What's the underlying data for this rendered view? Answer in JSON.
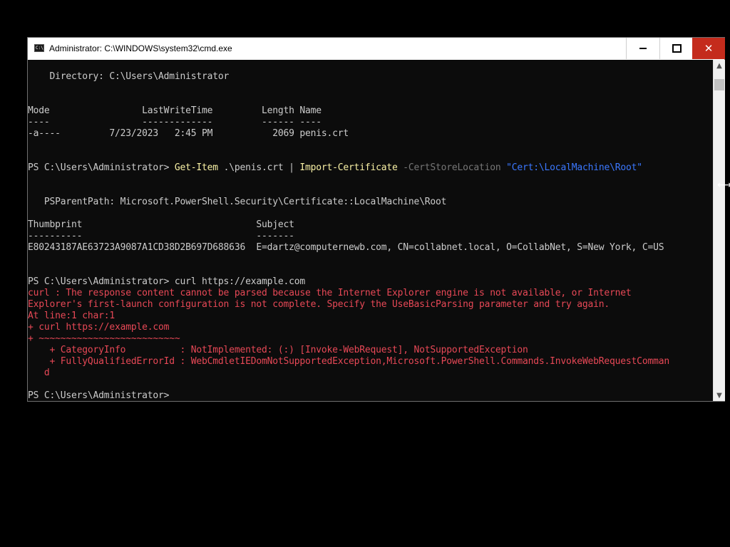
{
  "window": {
    "title": "Administrator: C:\\WINDOWS\\system32\\cmd.exe",
    "icon": "cmd-console-icon",
    "icon_text": "C:\\"
  },
  "controls": {
    "minimize": "minimize-icon",
    "maximize": "maximize-icon",
    "close": "close-icon",
    "close_glyph": "✕"
  },
  "colors": {
    "console_bg": "#0c0c0c",
    "text": "#cccccc",
    "cmdlet": "#f9f1a5",
    "parameter": "#767676",
    "string": "#3b78ff",
    "error": "#e74856",
    "close_hover": "#c42b1c"
  },
  "console": {
    "directory": "    Directory: C:\\Users\\Administrator",
    "listing_header": "Mode                 LastWriteTime         Length Name",
    "listing_sep": "----                 -------------         ------ ----",
    "listing_row": "-a----         7/23/2023   2:45 PM           2069 penis.crt",
    "cmd1": {
      "prompt": "PS C:\\Users\\Administrator> ",
      "cmdlet1": "Get-Item",
      "arg1": " .\\penis.crt | ",
      "cmdlet2": "Import-Certificate",
      "param": " -CertStoreLocation ",
      "string": "\"Cert:\\LocalMachine\\Root\""
    },
    "psparent": "   PSParentPath: Microsoft.PowerShell.Security\\Certificate::LocalMachine\\Root",
    "cert_header": "Thumbprint                                Subject",
    "cert_sep": "----------                                -------",
    "cert_row": "E80243187AE63723A9087A1CD38D2B697D688636  E=dartz@computernewb.com, CN=collabnet.local, O=CollabNet, S=New York, C=US",
    "cmd2": "PS C:\\Users\\Administrator> curl https://example.com",
    "errors": [
      "curl : The response content cannot be parsed because the Internet Explorer engine is not available, or Internet",
      "Explorer's first-launch configuration is not complete. Specify the UseBasicParsing parameter and try again.",
      "At line:1 char:1",
      "+ curl https://example.com",
      "+ ~~~~~~~~~~~~~~~~~~~~~~~~~~",
      "    + CategoryInfo          : NotImplemented: (:) [Invoke-WebRequest], NotSupportedException",
      "    + FullyQualifiedErrorId : WebCmdletIEDomNotSupportedException,Microsoft.PowerShell.Commands.InvokeWebRequestComman",
      "   d"
    ],
    "final_prompt": "PS C:\\Users\\Administrator> "
  },
  "scrollbar": {
    "up_glyph": "▲",
    "down_glyph": "▼"
  },
  "cursor": {
    "glyph": "⟷"
  }
}
